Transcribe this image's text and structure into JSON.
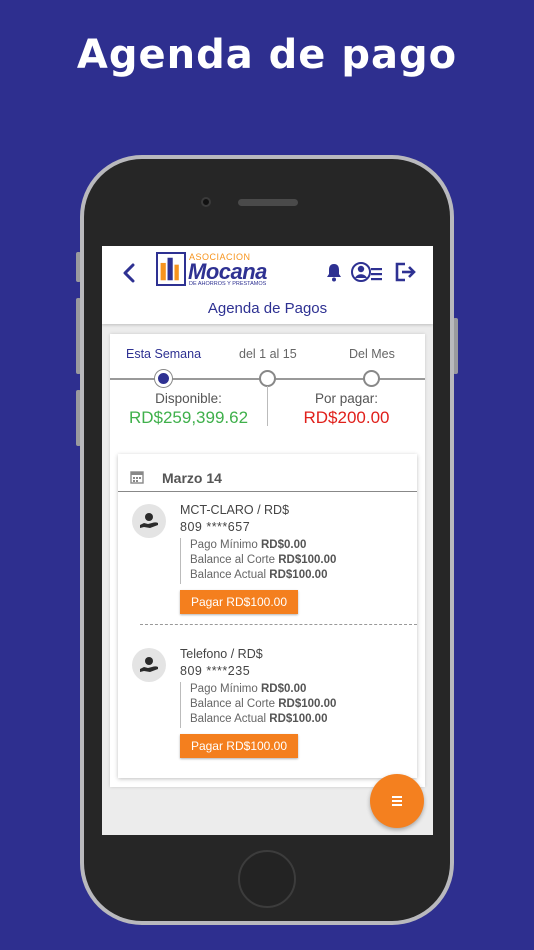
{
  "promo": {
    "title": "Agenda de pago"
  },
  "header": {
    "logo_top": "ASOCIACION",
    "logo_main": "Mocana",
    "logo_sub": "DE AHORROS Y PRESTAMOS",
    "title": "Agenda de Pagos"
  },
  "tabs": [
    {
      "label": "Esta Semana",
      "selected": true
    },
    {
      "label": "del 1 al 15",
      "selected": false
    },
    {
      "label": "Del Mes",
      "selected": false
    }
  ],
  "balances": {
    "available_label": "Disponible:",
    "available_value": "RD$259,399.62",
    "due_label": "Por pagar:",
    "due_value": "RD$200.00"
  },
  "schedule": {
    "date": "Marzo 14",
    "bills": [
      {
        "name": "MCT-CLARO / RD$",
        "account": "809 ****657",
        "min_label": "Pago Mínimo",
        "min_value": "RD$0.00",
        "cut_label": "Balance al Corte",
        "cut_value": "RD$100.00",
        "current_label": "Balance Actual",
        "current_value": "RD$100.00",
        "pay_label": "Pagar RD$100.00"
      },
      {
        "name": "Telefono / RD$",
        "account": "809 ****235",
        "min_label": "Pago Mínimo",
        "min_value": "RD$0.00",
        "cut_label": "Balance al Corte",
        "cut_value": "RD$100.00",
        "current_label": "Balance Actual",
        "current_value": "RD$100.00",
        "pay_label": "Pagar RD$100.00"
      }
    ]
  },
  "colors": {
    "background": "#2e2f8f",
    "brand_blue": "#2e3192",
    "accent_orange": "#f47f1e",
    "available_green": "#3fb04b",
    "due_red": "#e0201b"
  },
  "icons": [
    "back-arrow-icon",
    "bell-icon",
    "advisor-icon",
    "logout-icon",
    "calendar-icon",
    "money-hand-icon",
    "menu-icon"
  ]
}
